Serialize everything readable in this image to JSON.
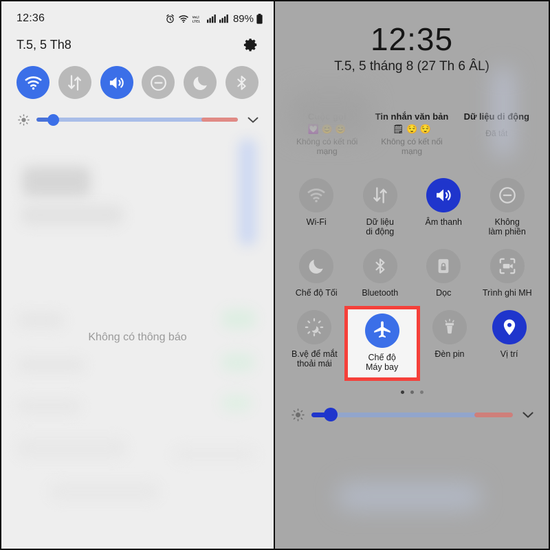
{
  "left_panel": {
    "status_bar": {
      "time": "12:36",
      "battery_percent": "89%",
      "icons": [
        "alarm-icon",
        "wifi-icon",
        "volte-icon",
        "signal-sim1-icon",
        "signal-sim2-icon",
        "battery-icon"
      ]
    },
    "date": "T.5, 5 Th8",
    "settings_icon": "gear-icon",
    "quick_toggles": [
      {
        "name": "wifi",
        "icon": "wifi-icon",
        "state": "on"
      },
      {
        "name": "mobile-data",
        "icon": "data-transfer-icon",
        "state": "off"
      },
      {
        "name": "sound",
        "icon": "volume-icon",
        "state": "on"
      },
      {
        "name": "do-not-disturb",
        "icon": "minus-circle-icon",
        "state": "off"
      },
      {
        "name": "dark-mode",
        "icon": "moon-icon",
        "state": "off"
      },
      {
        "name": "bluetooth",
        "icon": "bluetooth-icon",
        "state": "off"
      }
    ],
    "brightness": {
      "icon": "brightness-icon",
      "value_percent": 8,
      "expand_icon": "chevron-down-icon"
    },
    "empty_notifications": "Không có thông báo"
  },
  "right_panel": {
    "clock": {
      "time": "12:35",
      "date": "T.5, 5 tháng 8 (27 Th 6 ÂL)"
    },
    "status_columns": [
      {
        "title": "Cuộc gọi",
        "emoji": "💟 😊 😊",
        "subtitle": "Không có kết nối mạng"
      },
      {
        "title": "Tin nhắn văn bản",
        "emoji": "🗒 😌 😌",
        "subtitle": "Không có kết nối mạng"
      },
      {
        "title": "Dữ liệu di động",
        "emoji": "",
        "subtitle": "Đã tắt"
      }
    ],
    "tiles": [
      [
        {
          "label": "Wi-Fi",
          "icon": "wifi-icon",
          "state": "off",
          "highlighted": false
        },
        {
          "label": "Dữ liệu\ndi động",
          "icon": "data-transfer-icon",
          "state": "off",
          "highlighted": false
        },
        {
          "label": "Âm thanh",
          "icon": "volume-icon",
          "state": "on",
          "highlighted": false
        },
        {
          "label": "Không\nlàm phiền",
          "icon": "minus-circle-icon",
          "state": "off",
          "highlighted": false
        }
      ],
      [
        {
          "label": "Chế độ Tối",
          "icon": "moon-icon",
          "state": "off",
          "highlighted": false
        },
        {
          "label": "Bluetooth",
          "icon": "bluetooth-icon",
          "state": "off",
          "highlighted": false
        },
        {
          "label": "Dọc",
          "icon": "rotation-lock-icon",
          "state": "off",
          "highlighted": false
        },
        {
          "label": "Trình ghi MH",
          "icon": "screen-recorder-icon",
          "state": "off",
          "highlighted": false
        }
      ],
      [
        {
          "label": "B.vệ để mắt\nthoải mái",
          "icon": "eye-comfort-icon",
          "state": "off",
          "highlighted": false
        },
        {
          "label": "Chế độ\nMáy bay",
          "icon": "airplane-icon",
          "state": "on",
          "highlighted": true
        },
        {
          "label": "Đèn pin",
          "icon": "flashlight-icon",
          "state": "off",
          "highlighted": false
        },
        {
          "label": "Vị trí",
          "icon": "location-pin-icon",
          "state": "on",
          "highlighted": false
        }
      ]
    ],
    "page_dots": {
      "count": 3,
      "active_index": 0
    },
    "brightness": {
      "icon": "brightness-icon",
      "value_percent": 8,
      "expand_icon": "chevron-down-icon"
    }
  },
  "colors": {
    "accent_blue": "#3B6FE8",
    "accent_blue_dark": "#1F35CC",
    "toggle_off_grey": "#B9B9B9",
    "highlight_red": "#F5403A",
    "slider_warm": "#E08A85",
    "left_bg": "#EEEEEE",
    "right_bg": "#A8A8A8"
  }
}
